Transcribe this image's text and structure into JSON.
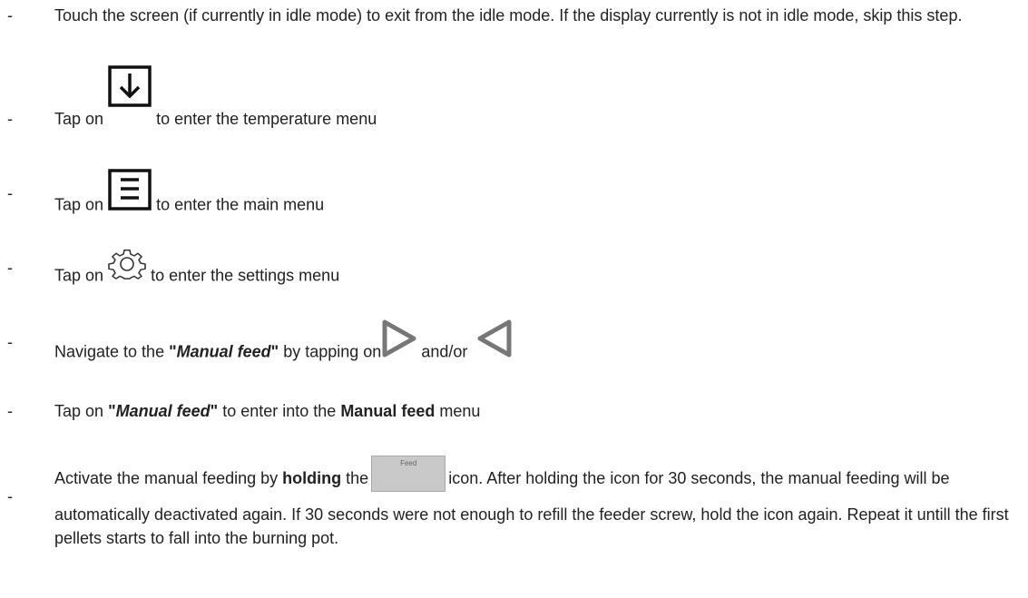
{
  "steps": [
    {
      "dash": "-",
      "text": "Touch the screen (if currently in idle mode) to exit from the idle mode. If the display currently is not in idle mode, skip this step."
    },
    {
      "dash": "-",
      "prefix": "Tap on",
      "icon": "down-arrow-box-icon",
      "suffix": "to enter the temperature menu"
    },
    {
      "dash": "-",
      "prefix": "Tap on",
      "icon": "menu-lines-box-icon",
      "suffix": "to enter the main menu"
    },
    {
      "dash": "-",
      "prefix": "Tap on",
      "icon": "gear-icon",
      "suffix": "to enter the settings menu"
    },
    {
      "dash": "-",
      "prefix": "Navigate to the",
      "quote_open": "\"",
      "term": "Manual feed",
      "quote_close": "\"",
      "mid": "by tapping on",
      "icon_right": "right-triangle-icon",
      "and_or": "and/or",
      "icon_left": "left-triangle-icon"
    },
    {
      "dash": "-",
      "prefix": "Tap on",
      "quote_open": "\"",
      "term": "Manual feed",
      "quote_close": "\"",
      "mid": "to enter into the",
      "menu_name": "Manual feed",
      "suffix": "menu"
    },
    {
      "dash": "-",
      "prefix": "Activate the manual feeding by",
      "bold_word": "holding",
      "the_word": "the",
      "button_label": "Feed",
      "suffix": "icon. After holding the icon for 30 seconds, the manual feeding will be automatically deactivated again. If 30 seconds were not enough to refill the feeder screw, hold the icon again. Repeat it untill the first pellets starts to fall into the burning pot."
    }
  ]
}
